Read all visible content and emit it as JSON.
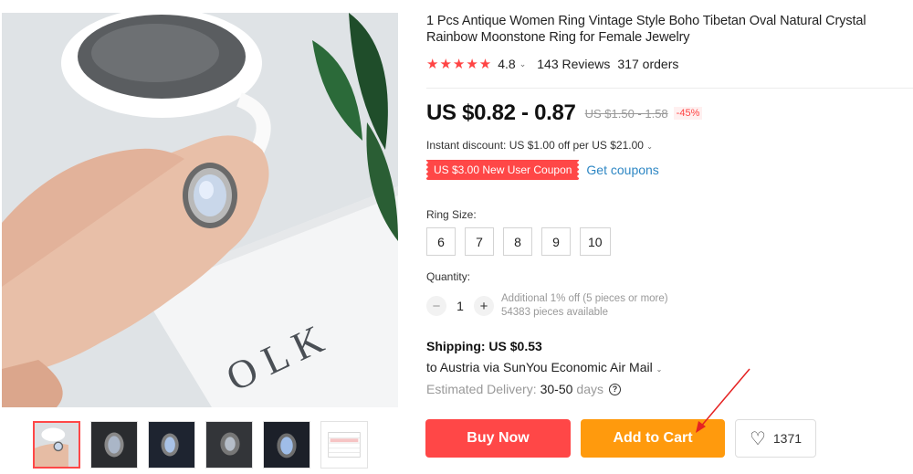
{
  "product": {
    "title": "1 Pcs Antique Women Ring Vintage Style Boho Tibetan Oval Natural Crystal Rainbow Moonstone Ring for Female Jewelry",
    "rating": "4.8",
    "rating_chevron": "⌄",
    "reviews": "143 Reviews",
    "orders": "317 orders",
    "stars": "★★★★★"
  },
  "price": {
    "current": "US $0.82 - 0.87",
    "original": "US $1.50 - 1.58",
    "discount": "-45%"
  },
  "instant_discount": "Instant discount: US $1.00 off per US $21.00",
  "coupon": {
    "label": "US $3.00 New User Coupon",
    "link": "Get coupons"
  },
  "ring_size": {
    "label": "Ring Size:",
    "options": [
      "6",
      "7",
      "8",
      "9",
      "10"
    ]
  },
  "quantity": {
    "label": "Quantity:",
    "minus": "−",
    "value": "1",
    "plus": "+",
    "note_line1": "Additional 1% off (5 pieces or more)",
    "note_line2": "54383 pieces available"
  },
  "shipping": {
    "title": "Shipping: US $0.53",
    "to": "to Austria via SunYou Economic Air Mail",
    "delivery_label": "Estimated Delivery:",
    "delivery_value": "30-50",
    "delivery_unit": "days",
    "help_icon": "?"
  },
  "buttons": {
    "buy": "Buy Now",
    "cart": "Add to Cart",
    "wishlist_count": "1371",
    "heart": "♡"
  },
  "colors": {
    "accent_red": "#ff4747",
    "accent_orange": "#ff9a0d",
    "link_blue": "#2e87c4"
  }
}
